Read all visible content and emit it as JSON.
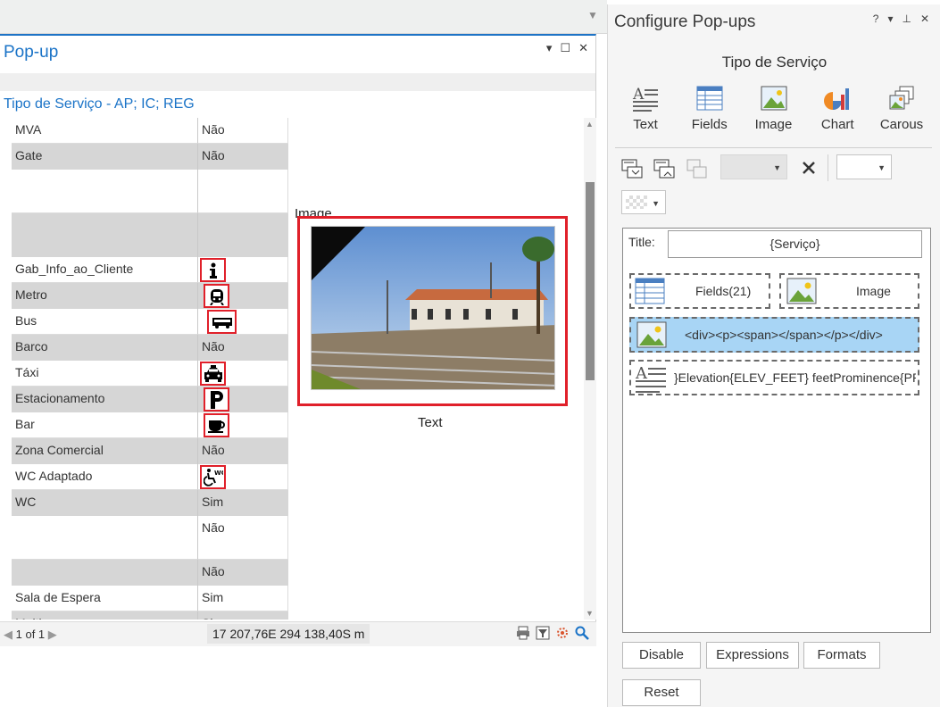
{
  "popup": {
    "title": "Pop-up",
    "subtitle": "Tipo de Serviço - AP; IC; REG",
    "fields": [
      {
        "name": "MVA",
        "value": "Não",
        "style": "white",
        "h": 29
      },
      {
        "name": "Gate",
        "value": "Não",
        "style": "gray",
        "h": 29
      },
      {
        "name": "",
        "value": "",
        "style": "white",
        "h": 49
      },
      {
        "name": "",
        "value": "",
        "style": "gray",
        "h": 49
      },
      {
        "name": "Gab_Info_ao_Cliente",
        "value": "",
        "icon": "info-icon",
        "style": "white",
        "h": 29
      },
      {
        "name": "Metro",
        "value": "",
        "icon": "metro-icon",
        "style": "gray",
        "h": 29
      },
      {
        "name": "Bus",
        "value": "",
        "icon": "bus-icon",
        "style": "white",
        "h": 29
      },
      {
        "name": "Barco",
        "value": "Não",
        "style": "gray",
        "h": 29
      },
      {
        "name": "Táxi",
        "value": "",
        "icon": "taxi-icon",
        "style": "white",
        "h": 29
      },
      {
        "name": "Estacionamento",
        "value": "",
        "icon": "parking-icon",
        "style": "gray",
        "h": 29
      },
      {
        "name": "Bar",
        "value": "",
        "icon": "coffee-icon",
        "style": "white",
        "h": 29
      },
      {
        "name": "Zona Comercial",
        "value": "Não",
        "style": "gray",
        "h": 29
      },
      {
        "name": "WC Adaptado",
        "value": "",
        "icon": "accessible-wc-icon",
        "style": "white",
        "h": 29
      },
      {
        "name": "WC",
        "value": "Sim",
        "style": "gray",
        "h": 29
      },
      {
        "name": "",
        "value": "Não",
        "style": "white",
        "h": 49
      },
      {
        "name": "",
        "value": "Não",
        "style": "gray",
        "h": 29
      },
      {
        "name": "Sala de Espera",
        "value": "Sim",
        "style": "white",
        "h": 29
      },
      {
        "name": "Multi",
        "value": "Sim",
        "style": "gray",
        "h": 29
      }
    ],
    "image_label": "Image",
    "text_label": "Text",
    "footer": {
      "nav": "1 of 1",
      "coords": "17 207,76E 294 138,40S m"
    }
  },
  "config": {
    "title": "Configure Pop-ups",
    "layer_name": "Tipo de Serviço",
    "elements": [
      {
        "label": "Text",
        "icon": "text-icon"
      },
      {
        "label": "Fields",
        "icon": "fields-icon"
      },
      {
        "label": "Image",
        "icon": "image-icon"
      },
      {
        "label": "Chart",
        "icon": "chart-icon"
      },
      {
        "label": "Carous",
        "icon": "carousel-icon"
      }
    ],
    "title_label": "Title:",
    "title_value": "{Serviço}",
    "cards": {
      "fields": "Fields(21)",
      "image": "Image",
      "html": "<div><p><span></span></p></div>",
      "text": "}Elevation{ELEV_FEET} feetProminence{PR"
    },
    "buttons": {
      "disable": "Disable",
      "expressions": "Expressions",
      "formats": "Formats",
      "reset": "Reset"
    }
  }
}
